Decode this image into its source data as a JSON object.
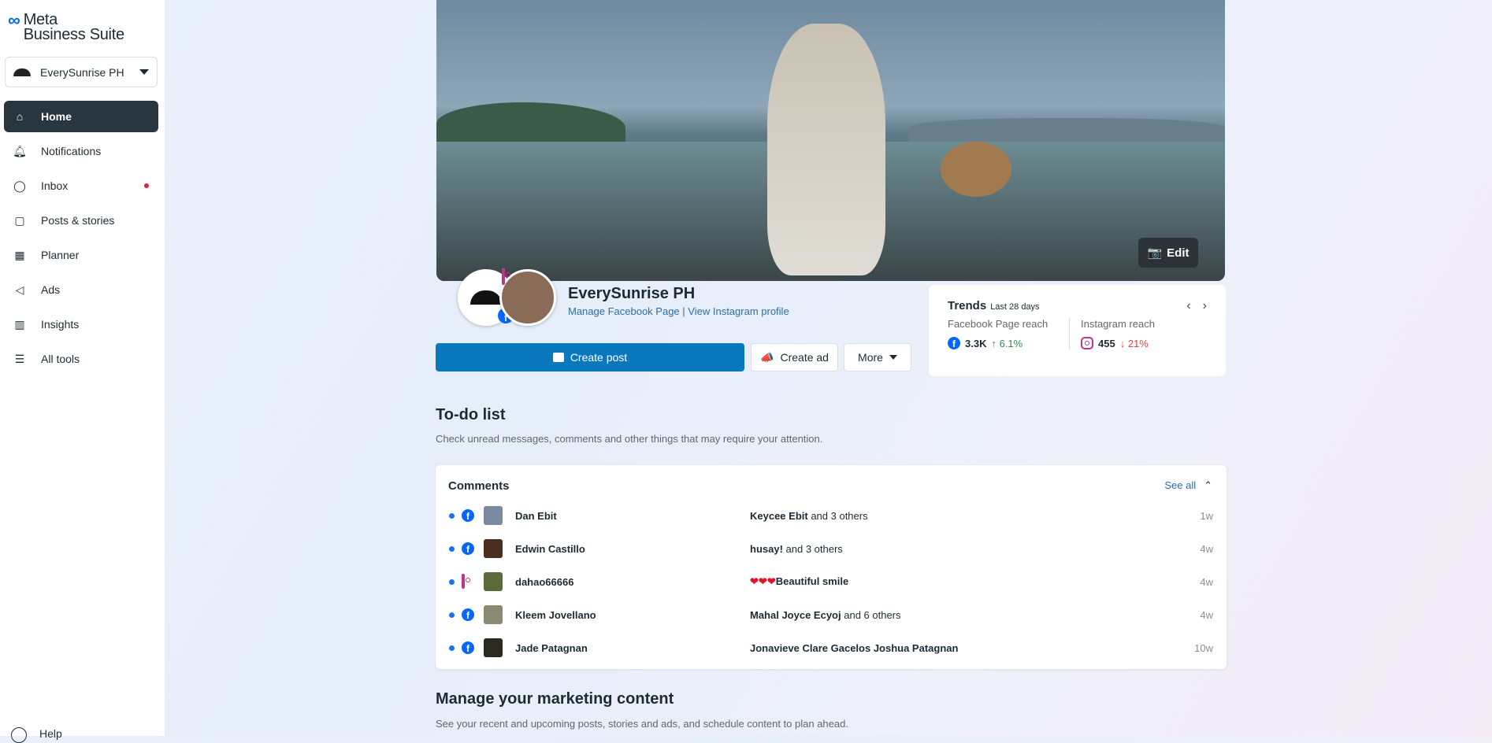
{
  "brand": {
    "line1": "Meta",
    "line2": "Business Suite"
  },
  "account": {
    "name": "EverySunrise PH"
  },
  "nav": [
    {
      "label": "Home",
      "icon": "home-icon"
    },
    {
      "label": "Notifications",
      "icon": "bell-icon"
    },
    {
      "label": "Inbox",
      "icon": "chat-icon",
      "badge": true
    },
    {
      "label": "Posts & stories",
      "icon": "posts-icon"
    },
    {
      "label": "Planner",
      "icon": "calendar-icon"
    },
    {
      "label": "Ads",
      "icon": "megaphone-icon"
    },
    {
      "label": "Insights",
      "icon": "bar-chart-icon"
    },
    {
      "label": "All tools",
      "icon": "menu-icon"
    }
  ],
  "help": "Help",
  "banner": {
    "edit": "Edit"
  },
  "profile": {
    "name": "EverySunrise PH",
    "manage_fb": "Manage Facebook Page",
    "sep": "|",
    "view_ig": "View Instagram profile"
  },
  "actions": {
    "create_post": "Create post",
    "create_ad": "Create ad",
    "more": "More"
  },
  "trends": {
    "title": "Trends",
    "period": "Last 28 days",
    "fb_label": "Facebook Page reach",
    "fb_value": "3.3K",
    "fb_change": "↑ 6.1%",
    "ig_label": "Instagram reach",
    "ig_value": "455",
    "ig_change": "↓ 21%",
    "colors": {
      "up": "#2e8b57",
      "down": "#d9453a"
    }
  },
  "todo": {
    "title": "To-do list",
    "subtitle": "Check unread messages, comments and other things that may require your attention."
  },
  "comments": {
    "title": "Comments",
    "see_all": "See all",
    "rows": [
      {
        "platform": "facebook",
        "name": "Dan Ebit",
        "bold": "Keycee Ebit",
        "rest": " and 3 others",
        "time": "1w"
      },
      {
        "platform": "facebook",
        "name": "Edwin Castillo",
        "bold": "husay!",
        "rest": " and 3 others",
        "time": "4w"
      },
      {
        "platform": "instagram",
        "name": "dahao66666",
        "bold": "❤❤❤Beautiful smile",
        "rest": "",
        "time": "4w"
      },
      {
        "platform": "facebook",
        "name": "Kleem Jovellano",
        "bold": "Mahal Joyce Ecyoj",
        "rest": " and 6 others",
        "time": "4w"
      },
      {
        "platform": "facebook",
        "name": "Jade Patagnan",
        "bold": "Jonavieve Clare Gacelos Joshua Patagnan",
        "rest": "",
        "time": "10w"
      }
    ]
  },
  "marketing": {
    "title": "Manage your marketing content",
    "subtitle": "See your recent and upcoming posts, stories and ads, and schedule content to plan ahead."
  }
}
